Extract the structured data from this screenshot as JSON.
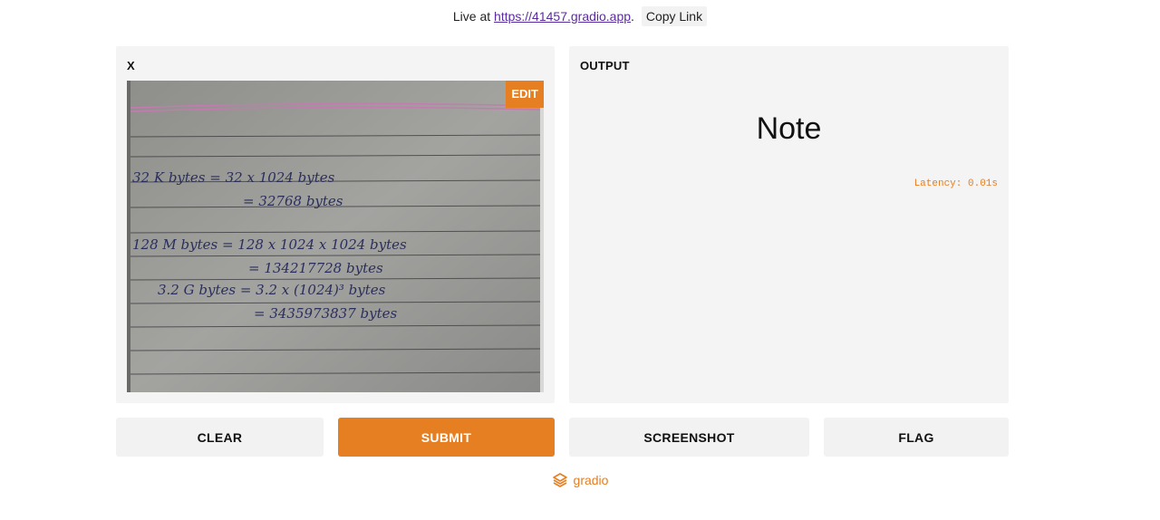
{
  "topbar": {
    "prefix": "Live at ",
    "url": "https://41457.gradio.app",
    "suffix": ".",
    "copy_label": "Copy Link"
  },
  "input_panel": {
    "label": "X",
    "edit_label": "EDIT",
    "image_lines": [
      "32 K bytes = 32 x 1024 bytes",
      "= 32768 bytes",
      "128 M bytes = 128 x 1024 x 1024 bytes",
      "= 134217728 bytes",
      "3.2 G bytes = 3.2 x (1024)³ bytes",
      "= 3435973837 bytes"
    ]
  },
  "output_panel": {
    "label": "OUTPUT",
    "result": "Note",
    "latency": "Latency: 0.01s"
  },
  "buttons": {
    "clear": "CLEAR",
    "submit": "SUBMIT",
    "screenshot": "SCREENSHOT",
    "flag": "FLAG"
  },
  "footer": {
    "brand": "gradio"
  },
  "colors": {
    "accent": "#e67e22",
    "panel_bg": "#f4f4f4",
    "button_bg": "#f2f2f2"
  }
}
